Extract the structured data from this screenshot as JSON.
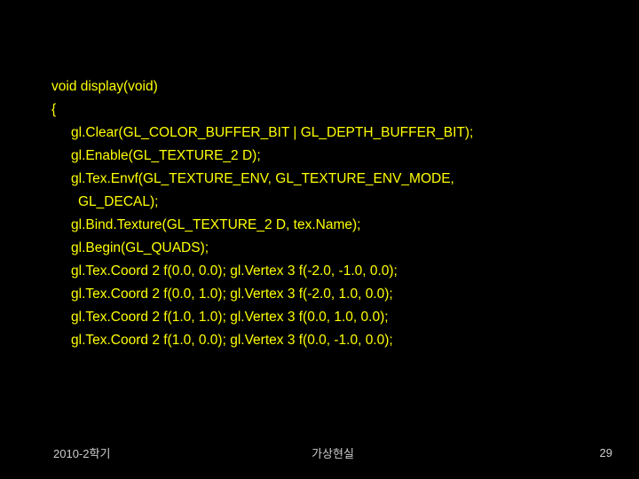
{
  "code": {
    "l0": "void display(void)",
    "l1": "{",
    "l2": "gl.Clear(GL_COLOR_BUFFER_BIT | GL_DEPTH_BUFFER_BIT);",
    "l3": "gl.Enable(GL_TEXTURE_2 D);",
    "l4": "gl.Tex.Envf(GL_TEXTURE_ENV, GL_TEXTURE_ENV_MODE,",
    "l5": "GL_DECAL);",
    "l6": "gl.Bind.Texture(GL_TEXTURE_2 D, tex.Name);",
    "l7": "gl.Begin(GL_QUADS);",
    "l8": "gl.Tex.Coord 2 f(0.0, 0.0); gl.Vertex 3 f(-2.0, -1.0, 0.0);",
    "l9": "gl.Tex.Coord 2 f(0.0, 1.0); gl.Vertex 3 f(-2.0, 1.0, 0.0);",
    "l10": "gl.Tex.Coord 2 f(1.0, 1.0); gl.Vertex 3 f(0.0, 1.0, 0.0);",
    "l11": "gl.Tex.Coord 2 f(1.0, 0.0); gl.Vertex 3 f(0.0, -1.0, 0.0);"
  },
  "footer": {
    "left": "2010-2학기",
    "center": "가상현실",
    "right": "29"
  }
}
